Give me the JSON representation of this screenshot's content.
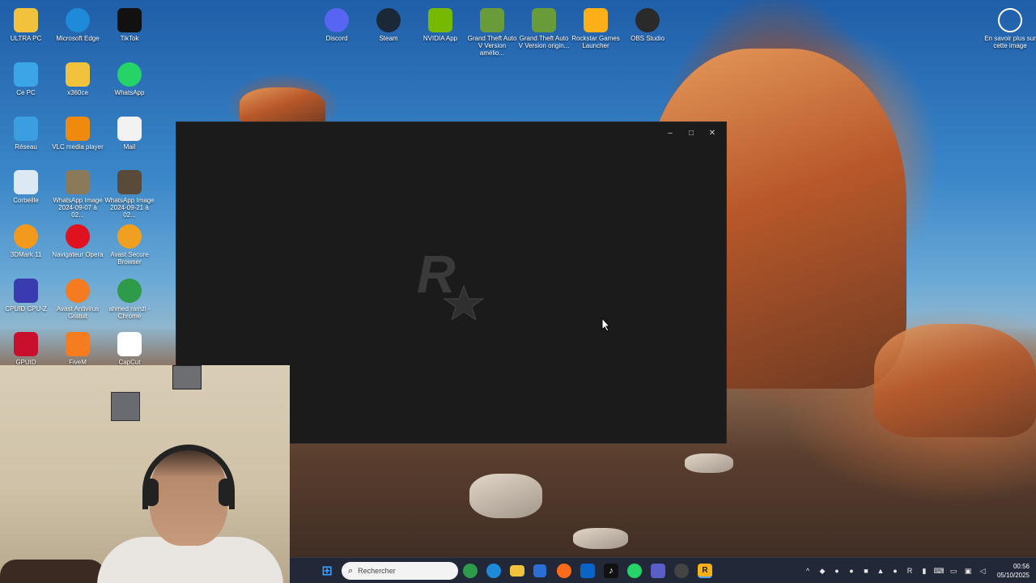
{
  "desktop": {
    "icons": [
      {
        "label": "ULTRA PC",
        "icon": "folder-icon",
        "color": "#f3c23c"
      },
      {
        "label": "Microsoft Edge",
        "icon": "edge-icon",
        "color": "#1f8ad8"
      },
      {
        "label": "TikTok",
        "icon": "tiktok-icon",
        "color": "#111111"
      },
      {
        "label": "Ce PC",
        "icon": "monitor-icon",
        "color": "#3aa6e8"
      },
      {
        "label": "x360ce",
        "icon": "folder-icon",
        "color": "#f3c23c"
      },
      {
        "label": "WhatsApp",
        "icon": "whatsapp-icon",
        "color": "#25d366"
      },
      {
        "label": "Réseau",
        "icon": "network-icon",
        "color": "#3a9ee0"
      },
      {
        "label": "VLC media player",
        "icon": "vlc-cone-icon",
        "color": "#f08a0c"
      },
      {
        "label": "Mail",
        "icon": "mail-icon",
        "color": "#f2f2f2"
      },
      {
        "label": "Corbeille",
        "icon": "recycle-bin-icon",
        "color": "#dce9f5"
      },
      {
        "label": "WhatsApp Image 2024-09-07 à 02...",
        "icon": "image-thumbnail-icon",
        "color": "#8a7a5a"
      },
      {
        "label": "WhatsApp Image 2024-09-21 à 02...",
        "icon": "image-thumbnail-icon",
        "color": "#5a4a3a"
      },
      {
        "label": "3DMark 11",
        "icon": "3dmark-icon",
        "color": "#f39a1c"
      },
      {
        "label": "Navigateur Opera",
        "icon": "opera-icon",
        "color": "#e1121f"
      },
      {
        "label": "Avast Secure Browser",
        "icon": "avast-browser-icon",
        "color": "#f0a020"
      },
      {
        "label": "CPUID CPU-Z",
        "icon": "cpuz-icon",
        "color": "#3b3bb0"
      },
      {
        "label": "Avast Antivirus Gratuit",
        "icon": "avast-icon",
        "color": "#f57b20"
      },
      {
        "label": "ahmed ramzi - Chrome",
        "icon": "chrome-icon",
        "color": "#2d9b4a"
      },
      {
        "label": "GPUID",
        "icon": "gpuid-icon",
        "color": "#c8102e"
      },
      {
        "label": "FiveM",
        "icon": "fivem-icon",
        "color": "#f57c1f"
      },
      {
        "label": "CapCut",
        "icon": "capcut-icon",
        "color": "#ffffff"
      },
      {
        "label": "Discord",
        "icon": "discord-icon",
        "color": "#5865f2"
      },
      {
        "label": "Steam",
        "icon": "steam-icon",
        "color": "#1b2838"
      },
      {
        "label": "NVIDIA App",
        "icon": "nvidia-icon",
        "color": "#76b900"
      },
      {
        "label": "Grand Theft Auto V Version amélio...",
        "icon": "gta-v-icon",
        "color": "#6a9b3a"
      },
      {
        "label": "Grand Theft Auto V Version origin...",
        "icon": "gta-v-icon",
        "color": "#6a9b3a"
      },
      {
        "label": "Rockstar Games Launcher",
        "icon": "rockstar-icon",
        "color": "#fcaf17"
      },
      {
        "label": "OBS Studio",
        "icon": "obs-icon",
        "color": "#2a2a2a"
      },
      {
        "label": "En savoir plus sur cette image",
        "icon": "learn-more-icon",
        "color": "#ffffff"
      }
    ]
  },
  "launcher_window": {
    "minimize": "–",
    "maximize": "□",
    "close": "✕",
    "logo_color": "#3a3a3a"
  },
  "taskbar": {
    "search_placeholder": "Rechercher",
    "clock_time": "00:56",
    "clock_date": "05/10/2025"
  }
}
